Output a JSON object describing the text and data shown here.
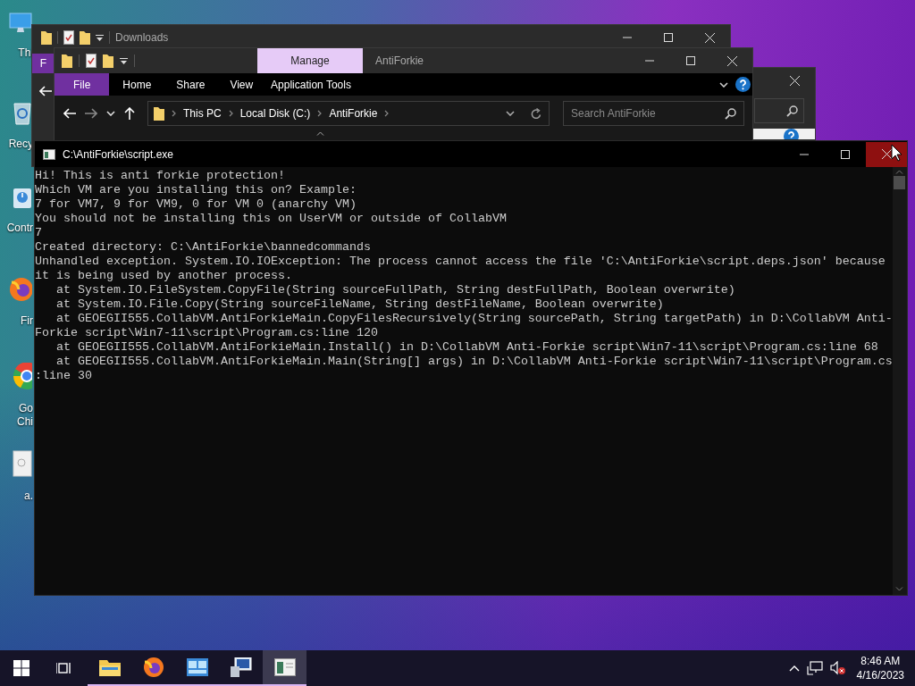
{
  "desktop": {
    "icons": [
      {
        "kind": "computer",
        "label": "Thi"
      },
      {
        "kind": "recycle_bin",
        "label": "Recy"
      },
      {
        "kind": "control_panel",
        "label": "Contr"
      },
      {
        "kind": "firefox",
        "label": "Fir"
      },
      {
        "kind": "chrome",
        "label": "Go\nChi"
      },
      {
        "kind": "file",
        "label": "a."
      }
    ]
  },
  "downloads_window": {
    "title": "Downloads",
    "ribbon_tab": "F"
  },
  "explorer_window": {
    "title": "AntiForkie",
    "context_tab": "Manage",
    "ribbon_tabs": [
      {
        "label": "File",
        "kind": "file"
      },
      {
        "label": "Home",
        "kind": "tab"
      },
      {
        "label": "Share",
        "kind": "tab"
      },
      {
        "label": "View",
        "kind": "tab"
      },
      {
        "label": "Application Tools",
        "kind": "context"
      }
    ],
    "breadcrumbs": [
      "This PC",
      "Local Disk (C:)",
      "AntiForkie"
    ],
    "search": {
      "placeholder": "Search AntiForkie"
    }
  },
  "console_window": {
    "title": "C:\\AntiForkie\\script.exe",
    "close_hovered": true,
    "lines": [
      "Hi! This is anti forkie protection!",
      "Which VM are you installing this on? Example:",
      "7 for VM7, 9 for VM9, 0 for VM 0 (anarchy VM)",
      "You should not be installing this on UserVM or outside of CollabVM",
      "7",
      "Created directory: C:\\AntiForkie\\bannedcommands",
      "Unhandled exception. System.IO.IOException: The process cannot access the file 'C:\\AntiForkie\\script.deps.json' because",
      "it is being used by another process.",
      "   at System.IO.FileSystem.CopyFile(String sourceFullPath, String destFullPath, Boolean overwrite)",
      "   at System.IO.File.Copy(String sourceFileName, String destFileName, Boolean overwrite)",
      "   at GEOEGII555.CollabVM.AntiForkieMain.CopyFilesRecursively(String sourcePath, String targetPath) in D:\\CollabVM Anti-",
      "Forkie script\\Win7-11\\script\\Program.cs:line 120",
      "   at GEOEGII555.CollabVM.AntiForkieMain.Install() in D:\\CollabVM Anti-Forkie script\\Win7-11\\script\\Program.cs:line 68",
      "   at GEOEGII555.CollabVM.AntiForkieMain.Main(String[] args) in D:\\CollabVM Anti-Forkie script\\Win7-11\\script\\Program.cs",
      ":line 30"
    ]
  },
  "taskbar": {
    "apps": [
      {
        "kind": "explorer",
        "selected": false
      },
      {
        "kind": "firefox",
        "selected": false
      },
      {
        "kind": "control_panel",
        "selected": false
      },
      {
        "kind": "remote_desktop",
        "selected": false
      },
      {
        "kind": "console",
        "selected": true
      }
    ],
    "clock": {
      "time": "8:46 AM",
      "date": "4/16/2023"
    }
  }
}
